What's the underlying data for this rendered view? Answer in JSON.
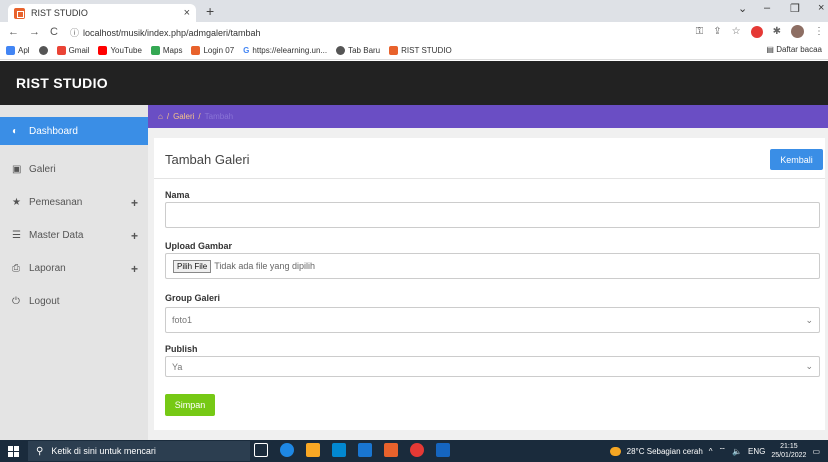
{
  "browser": {
    "tab_title": "RIST STUDIO",
    "tab_close": "×",
    "new_tab": "+",
    "url": "localhost/musik/index.php/admgaleri/tambah",
    "bookmarks": [
      "Apl",
      "Gmail",
      "YouTube",
      "Maps",
      "Login 07",
      "https://elearning.un...",
      "Tab Baru",
      "RIST STUDIO"
    ],
    "bookmarks_right": "Daftar bacaa"
  },
  "app": {
    "brand": "RIST STUDIO"
  },
  "sidebar": {
    "items": [
      {
        "label": "Dashboard",
        "icon": "dashboard-icon",
        "active": true
      },
      {
        "label": "Galeri",
        "icon": "image-icon"
      },
      {
        "label": "Pemesanan",
        "icon": "star-icon",
        "expand": "+"
      },
      {
        "label": "Master Data",
        "icon": "database-icon",
        "expand": "+"
      },
      {
        "label": "Laporan",
        "icon": "print-icon",
        "expand": "+"
      },
      {
        "label": "Logout",
        "icon": "power-icon"
      }
    ]
  },
  "breadcrumb": {
    "sep": "/",
    "items": [
      "Galeri",
      "Tambah"
    ]
  },
  "form": {
    "title": "Tambah Galeri",
    "back_label": "Kembali",
    "nama_label": "Nama",
    "nama_value": "",
    "upload_label": "Upload Gambar",
    "file_button": "Pilih File",
    "file_status": "Tidak ada file yang dipilih",
    "group_label": "Group Galeri",
    "group_value": "foto1",
    "publish_label": "Publish",
    "publish_value": "Ya",
    "save_label": "Simpan"
  },
  "taskbar": {
    "search_placeholder": "Ketik di sini untuk mencari",
    "weather": "28°C  Sebagian cerah",
    "lang": "ENG",
    "time": "21:15",
    "date": "25/01/2022"
  },
  "colors": {
    "primary": "#3a8ee6",
    "success": "#76c915",
    "breadcrumb_bg": "#6a4ec4",
    "navbar": "#222222"
  }
}
